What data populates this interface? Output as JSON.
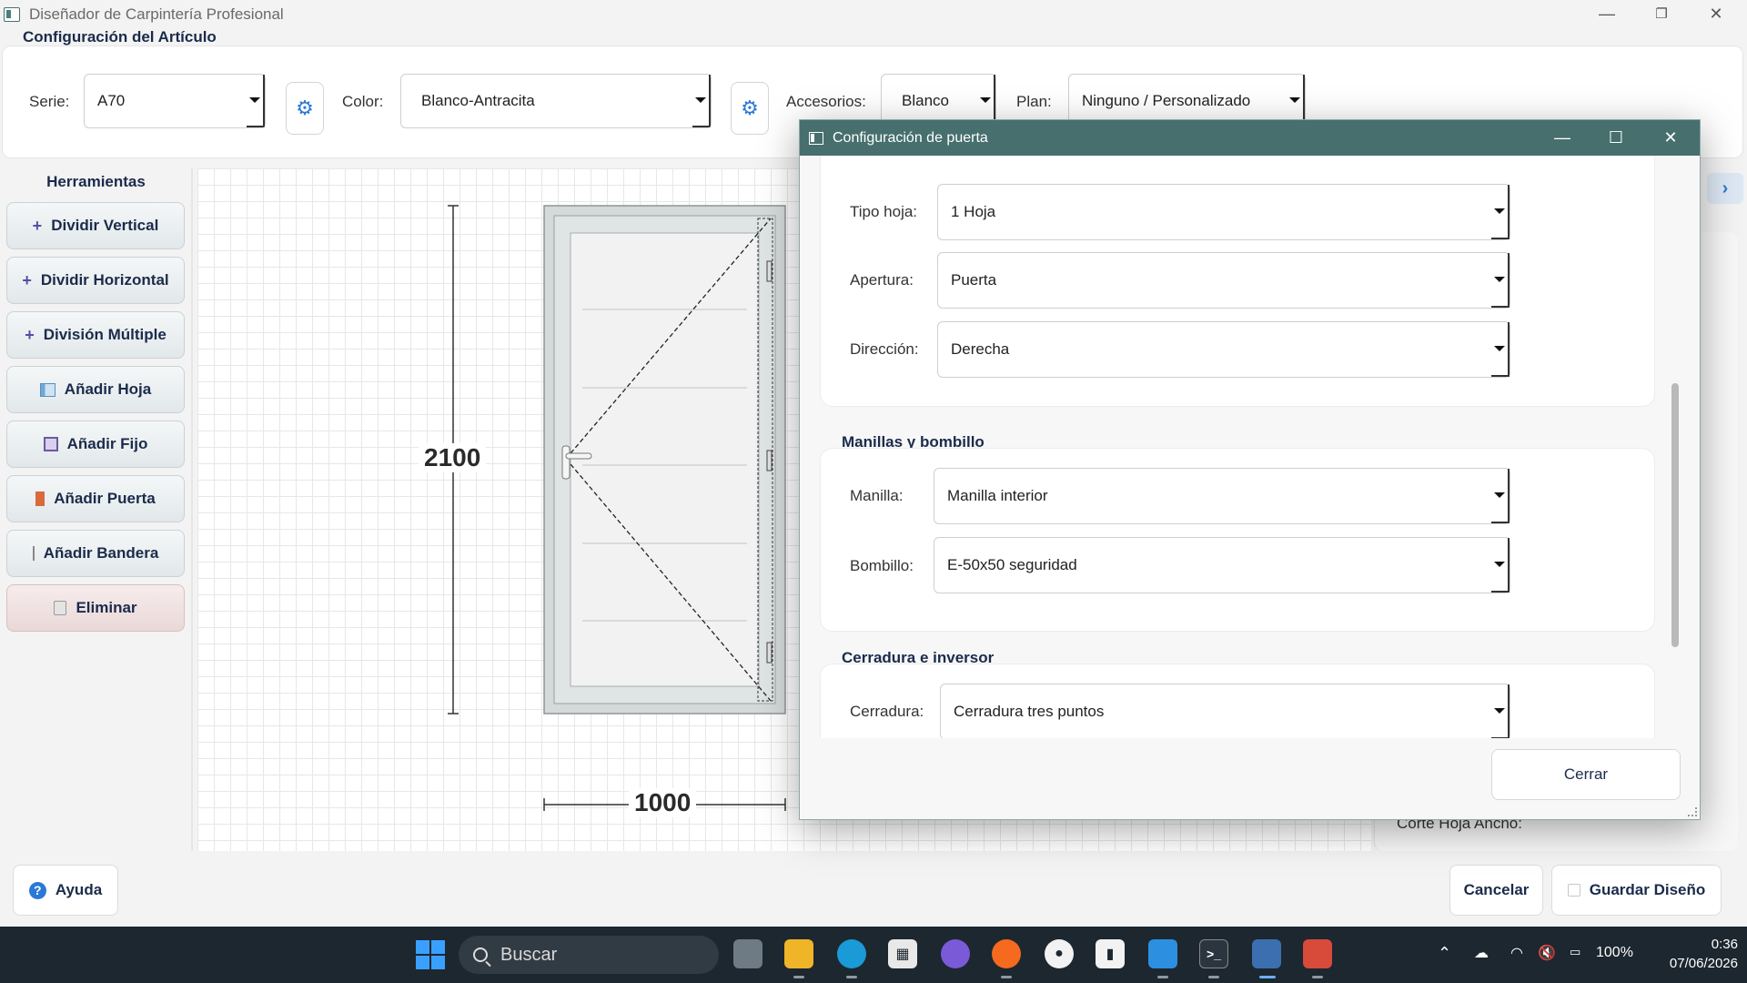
{
  "window": {
    "title": "Diseñador de Carpintería Profesional",
    "controls": {
      "minimize": "—",
      "restore": "❐",
      "close": "✕"
    }
  },
  "config": {
    "section_title": "Configuración del Artículo",
    "serie_label": "Serie:",
    "serie_value": "A70",
    "color_label": "Color:",
    "color_value": "Blanco-Antracita",
    "accesorios_label": "Accesorios:",
    "accesorios_value": "Blanco",
    "plan_label": "Plan:",
    "plan_value": "Ninguno / Personalizado"
  },
  "tools": {
    "title": "Herramientas",
    "items": [
      {
        "label": "Dividir Vertical",
        "icon": "plus-icon"
      },
      {
        "label": "Dividir Horizontal",
        "icon": "plus-icon"
      },
      {
        "label": "División Múltiple",
        "icon": "plus-icon"
      },
      {
        "label": "Añadir Hoja",
        "icon": "leaf-icon"
      },
      {
        "label": "Añadir Fijo",
        "icon": "square-icon"
      },
      {
        "label": "Añadir Puerta",
        "icon": "door-icon"
      },
      {
        "label": "Añadir Bandera",
        "icon": "flag-icon"
      },
      {
        "label": "Eliminar",
        "icon": "trash-icon"
      }
    ]
  },
  "drawing": {
    "height_dimension": "2100",
    "width_dimension": "1000"
  },
  "right_panel": {
    "partial_label": "Corte Hoja Ancho:"
  },
  "footer": {
    "help_label": "Ayuda",
    "cancel_label": "Cancelar",
    "save_label": "Guardar Diseño"
  },
  "dialog": {
    "title": "Configuración de puerta",
    "controls": {
      "minimize": "—",
      "maximize": "☐",
      "close": "✕"
    },
    "tipo_hoja_label": "Tipo hoja:",
    "tipo_hoja_value": "1 Hoja",
    "apertura_label": "Apertura:",
    "apertura_value": "Puerta",
    "direccion_label": "Dirección:",
    "direccion_value": "Derecha",
    "manillas_group_title": "Manillas y bombillo",
    "manilla_label": "Manilla:",
    "manilla_value": "Manilla interior",
    "bombillo_label": "Bombillo:",
    "bombillo_value": "E-50x50 seguridad",
    "cerradura_group_title": "Cerradura e inversor",
    "cerradura_label": "Cerradura:",
    "cerradura_value": "Cerradura tres puntos",
    "close_label": "Cerrar"
  },
  "taskbar": {
    "search_placeholder": "Buscar",
    "battery": "100%",
    "time": "0:36",
    "date": "07/06/2026"
  },
  "colors": {
    "accent": "#2b78d6",
    "dialog_titlebar": "#466f6d",
    "taskbar": "#1c2730",
    "heading": "#1b2b4b"
  }
}
